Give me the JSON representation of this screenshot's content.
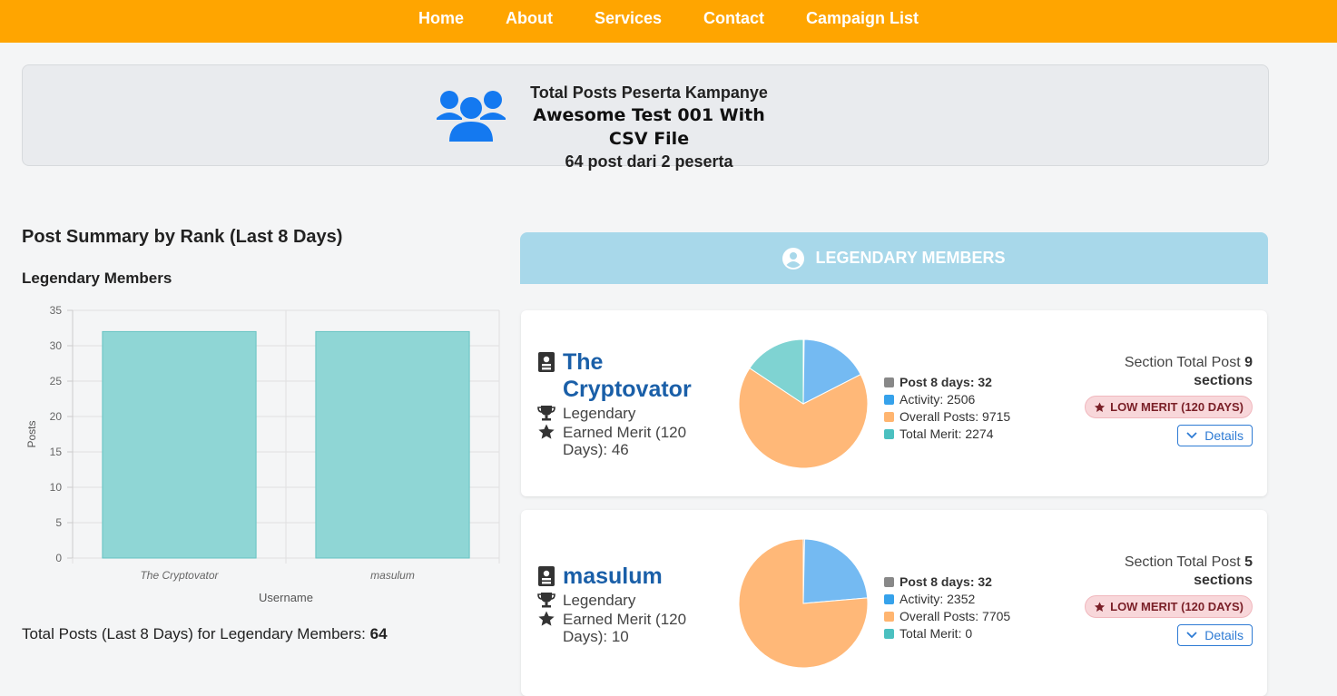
{
  "nav": {
    "items": [
      {
        "label": "Home"
      },
      {
        "label": "About"
      },
      {
        "label": "Services"
      },
      {
        "label": "Contact"
      },
      {
        "label": "Campaign List"
      }
    ]
  },
  "banner": {
    "line1": "Total Posts Peserta Kampanye",
    "line2": "Awesome Test 001 With CSV File",
    "line3": "64 post dari 2 peserta",
    "icon": "users-icon"
  },
  "summary": {
    "title": "Post Summary by Rank (Last 8 Days)",
    "subtitle": "Legendary Members",
    "total_prefix": "Total Posts (Last 8 Days) for Legendary Members: ",
    "total_value": "64"
  },
  "chart_data": {
    "type": "bar",
    "categories": [
      "The Cryptovator",
      "masulum"
    ],
    "values": [
      32,
      32
    ],
    "xlabel": "Username",
    "ylabel": "Posts",
    "ylim": [
      0,
      35
    ],
    "yticks": [
      0,
      5,
      10,
      15,
      20,
      25,
      30,
      35
    ],
    "grid": true,
    "color": "#8fd6d5"
  },
  "legendary_header": {
    "label": "LEGENDARY MEMBERS",
    "icon": "user-circle-icon"
  },
  "colors": {
    "nav_bg": "#ffa500",
    "posts8": "#888888",
    "activity": "#36a2eb",
    "overall": "#ffb570",
    "merit": "#4bc0c0"
  },
  "members": [
    {
      "name": "The Cryptovator",
      "rank": "Legendary",
      "merit_text": "Earned Merit (120 Days): 46",
      "legend": {
        "posts8": "Post 8 days: 32",
        "activity": "Activity: 2506",
        "overall": "Overall Posts: 9715",
        "merit": "Total Merit: 2274"
      },
      "pie": {
        "posts8": 32,
        "activity": 2506,
        "overall": 9715,
        "merit": 2274
      },
      "section_prefix": "Section Total Post ",
      "section_count": "9",
      "section_suffix": "sections",
      "badge": "LOW MERIT (120 DAYS)",
      "details": "Details"
    },
    {
      "name": "masulum",
      "rank": "Legendary",
      "merit_text": "Earned Merit (120 Days): 10",
      "legend": {
        "posts8": "Post 8 days: 32",
        "activity": "Activity: 2352",
        "overall": "Overall Posts: 7705",
        "merit": "Total Merit: 0"
      },
      "pie": {
        "posts8": 32,
        "activity": 2352,
        "overall": 7705,
        "merit": 0
      },
      "section_prefix": "Section Total Post ",
      "section_count": "5",
      "section_suffix": "sections",
      "badge": "LOW MERIT (120 DAYS)",
      "details": "Details"
    }
  ]
}
